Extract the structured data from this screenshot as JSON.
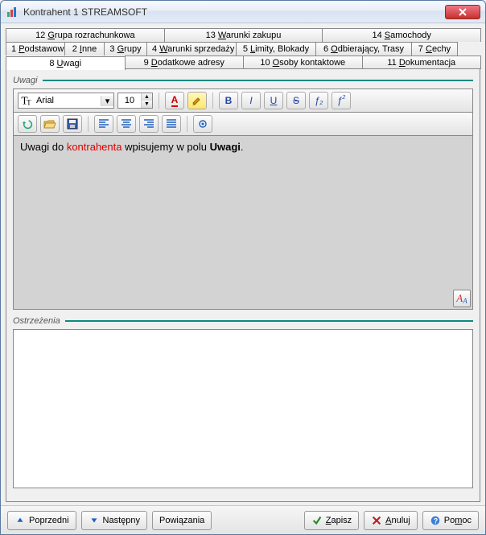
{
  "window": {
    "title": "Kontrahent  1  STREAMSOFT"
  },
  "tabs": {
    "row1": [
      {
        "num": "12",
        "label": "Grupa rozrachunkowa",
        "u": "G"
      },
      {
        "num": "13",
        "label": "Warunki zakupu",
        "u": "W"
      },
      {
        "num": "14",
        "label": "Samochody",
        "u": "S"
      }
    ],
    "row2": [
      {
        "num": "1",
        "label": "Podstawowe",
        "u": "P"
      },
      {
        "num": "2",
        "label": "Inne",
        "u": "I"
      },
      {
        "num": "3",
        "label": "Grupy",
        "u": "G"
      },
      {
        "num": "4",
        "label": "Warunki sprzedaży",
        "u": "W"
      },
      {
        "num": "5",
        "label": "Limity, Blokady",
        "u": "L"
      },
      {
        "num": "6",
        "label": "Odbierający, Trasy",
        "u": "O"
      },
      {
        "num": "7",
        "label": "Cechy",
        "u": "C"
      }
    ],
    "row3": [
      {
        "num": "8",
        "label": "Uwagi",
        "u": "U",
        "active": true
      },
      {
        "num": "9",
        "label": "Dodatkowe adresy",
        "u": "D"
      },
      {
        "num": "10",
        "label": "Osoby kontaktowe",
        "u": "O"
      },
      {
        "num": "11",
        "label": "Dokumentacja",
        "u": "D"
      }
    ]
  },
  "uwagi": {
    "legend": "Uwagi",
    "font_name": "Arial",
    "font_size": "10",
    "text_pre": "Uwagi do ",
    "text_red": "kontrahenta",
    "text_mid": " wpisujemy w polu ",
    "text_bold": "Uwagi",
    "text_post": "."
  },
  "ostrzezenia": {
    "legend": "Ostrzeżenia"
  },
  "footer": {
    "prev": "Poprzedni",
    "next": "Następny",
    "links": "Powiązania",
    "save": "Zapisz",
    "cancel": "Anuluj",
    "help": "Pomoc"
  },
  "icons": {
    "bold": "B",
    "italic": "I",
    "underline": "U",
    "strike": "S",
    "sub": "ƒ",
    "sup": "ƒ"
  }
}
